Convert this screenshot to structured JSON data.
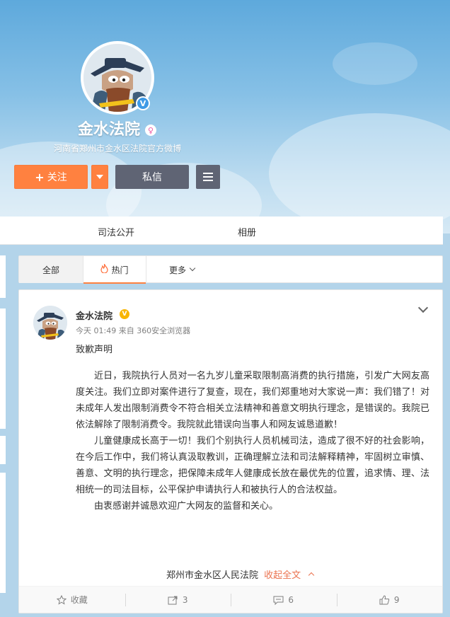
{
  "profile": {
    "name": "金水法院",
    "description": "河南省郑州市金水区法院官方微博",
    "verified_badge": "V",
    "gender_icon": "female-icon"
  },
  "actions": {
    "follow_label": "关注",
    "follow_plus": "+",
    "message_label": "私信"
  },
  "nav": {
    "items": [
      "司法公开",
      "相册"
    ]
  },
  "filter_tabs": {
    "all": "全部",
    "hot": "热门",
    "more": "更多"
  },
  "post": {
    "author": "金水法院",
    "vip_badge": "V",
    "meta": "今天 01:49 来自 360安全浏览器",
    "title": "致歉声明",
    "paragraphs": [
      "近日，我院执行人员对一名九岁儿童采取限制高消费的执行措施，引发广大网友高度关注。我们立即对案件进行了复查，现在，我们郑重地对大家说一声：我们错了！对未成年人发出限制消费令不符合相关立法精神和善意文明执行理念，是错误的。我院已依法解除了限制消费令。我院就此错误向当事人和网友诚恳道歉！",
      "儿童健康成长高于一切！我们个别执行人员机械司法，造成了很不好的社会影响，在今后工作中，我们将认真汲取教训，正确理解立法和司法解释精神，牢固树立审慎、善意、文明的执行理念，把保障未成年人健康成长放在最优先的位置，追求情、理、法相统一的司法目标，公平保护申请执行人和被执行人的合法权益。",
      "由衷感谢并诚恳欢迎广大网友的监督和关心。"
    ],
    "signature": "郑州市金水区人民法院",
    "collapse_label": "收起全文",
    "footer": {
      "favorite_label": "收藏",
      "repost_count": "3",
      "comment_count": "6",
      "like_count": "9"
    }
  },
  "colors": {
    "accent": "#ff8140",
    "dark_button": "#5f6474",
    "link": "#eb7350",
    "verified_blue": "#3e9ae6",
    "vip_gold": "#f8b500"
  }
}
